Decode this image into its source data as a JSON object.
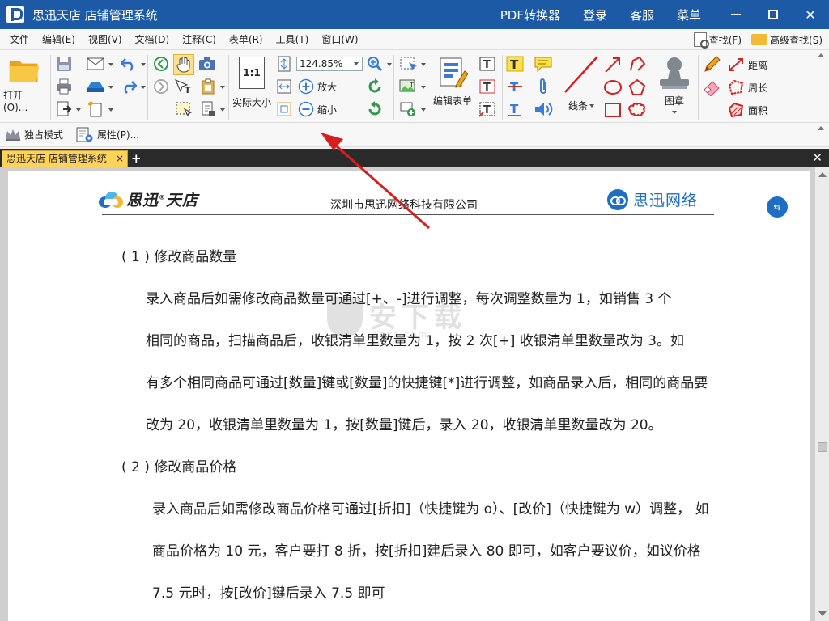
{
  "titlebar": {
    "title": "思迅天店 店铺管理系统",
    "links": [
      "PDF转换器",
      "登录",
      "客服",
      "菜单"
    ],
    "minimize": "",
    "close": "✕"
  },
  "menubar": {
    "items": [
      "文件",
      "编辑(E)",
      "视图(V)",
      "文档(D)",
      "注释(C)",
      "表单(R)",
      "工具(T)",
      "窗口(W)"
    ],
    "find_label": "查找(F)",
    "advanced_find_label": "高级查找(S)"
  },
  "toolbar": {
    "open_label": "打开(O)...",
    "actual_size_label": "实际大小",
    "actual_size_glyph": "1:1",
    "zoom_value": "124.85%",
    "zoom_in_label": "放大",
    "zoom_out_label": "缩小",
    "edit_form_label": "编辑表单",
    "lines_label": "线条",
    "stamp_label": "图章",
    "distance_label": "距离",
    "perimeter_label": "周长",
    "area_label": "面积"
  },
  "toolbar2": {
    "exclusive_mode_label": "独占模式",
    "properties_label": "属性(P)..."
  },
  "tabs": {
    "active_tab_label": "思迅天店 店铺管理系统",
    "close_glyph": "×",
    "add_glyph": "+",
    "close_all_glyph": "✕"
  },
  "document": {
    "header": {
      "brand_left": "思迅",
      "brand_left_reg": "®",
      "brand_left_2": "天店",
      "company": "深圳市思迅网络科技有限公司",
      "brand_right": "思迅网络"
    },
    "sections": [
      {
        "heading": "( 1 ) 修改商品数量",
        "lines": [
          "录入商品后如需修改商品数量可通过[+、-]进行调整，每次调整数量为 1，如销售 3 个",
          "相同的商品，扫描商品后，收银清单里数量为 1，按 2 次[+] 收银清单里数量改为 3。如",
          "有多个相同商品可通过[数量]键或[数量]的快捷键[*]进行调整，如商品录入后，相同的商品要",
          "改为 20，收银清单里数量为 1，按[数量]键后，录入 20，收银清单里数量改为 20。"
        ]
      },
      {
        "heading": "( 2 ) 修改商品价格",
        "lines": [
          "录入商品后如需修改商品价格可通过[折扣]（快捷键为 o）、[改价]（快捷键为 w）调整， 如",
          "商品价格为 10 元，客户要打 8 折，按[折扣]建后录入 80 即可，如客户要议价，如议价格",
          "7.5 元时，按[改价]键后录入 7.5 即可"
        ]
      }
    ],
    "watermark": {
      "text": "安下载",
      "sub": "anxz.com"
    },
    "float_button_glyph": "⇆"
  },
  "colors": {
    "titlebar": "#1c5aa6",
    "tab_active": "#ffd35a",
    "brand_blue": "#1e6fc4",
    "annotation_arrow": "#d61f1f"
  }
}
